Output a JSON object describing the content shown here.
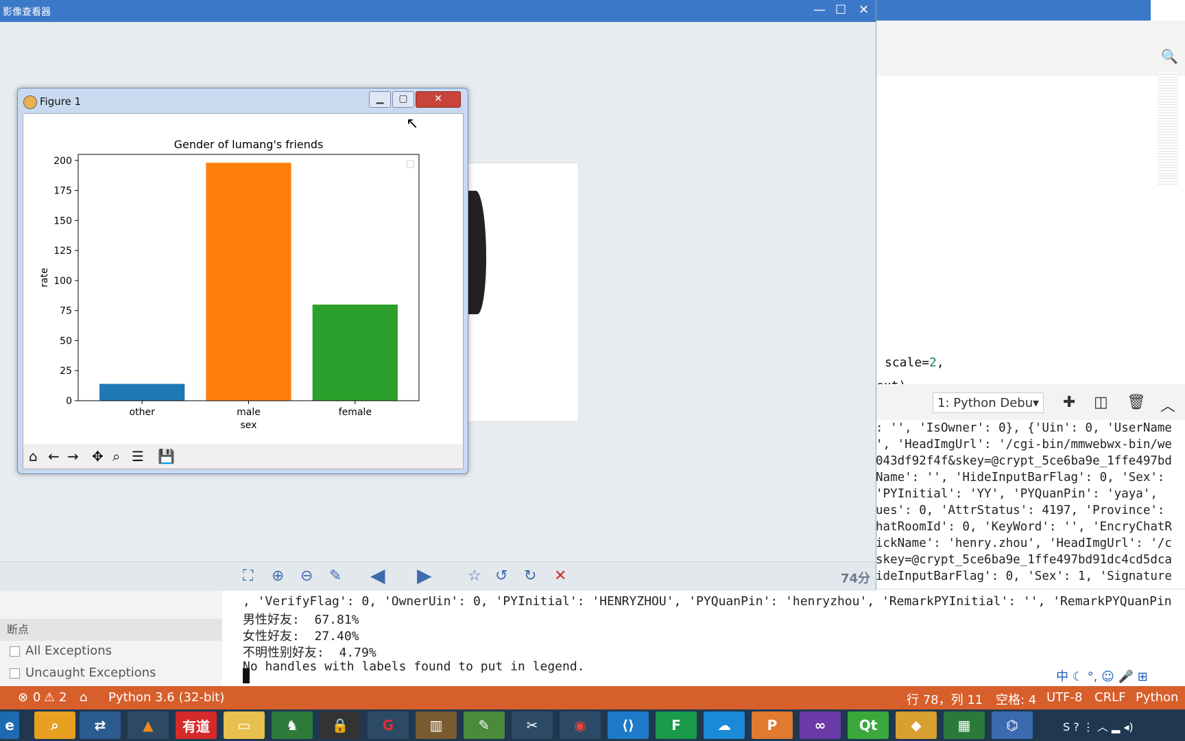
{
  "viewer": {
    "title": "影像查看器",
    "window_controls": {
      "minimize": "—",
      "maximize": "☐",
      "close": "✕"
    },
    "zoom": "74分",
    "toolbar_icons": [
      "fit-icon",
      "zoom-in-icon",
      "zoom-out-icon",
      "brush-icon",
      "prev-icon",
      "next-icon",
      "favorite-icon",
      "rotate-left-icon",
      "rotate-right-icon",
      "delete-icon"
    ]
  },
  "figure": {
    "title": "Figure 1",
    "toolbar_icons": [
      "home-icon",
      "back-icon",
      "forward-icon",
      "pan-icon",
      "zoom-icon",
      "configure-icon",
      "save-icon"
    ]
  },
  "chart_data": {
    "type": "bar",
    "title": "Gender of lumang's friends",
    "xlabel": "sex",
    "ylabel": "rate",
    "categories": [
      "other",
      "male",
      "female"
    ],
    "values": [
      14,
      198,
      80
    ],
    "colors": [
      "#1f77b4",
      "#ff7f0e",
      "#2ca02c"
    ],
    "ylim": [
      0,
      205
    ],
    "yticks": [
      0,
      25,
      50,
      75,
      100,
      125,
      150,
      175,
      200
    ],
    "grid": false,
    "legend": "top-right (empty)"
  },
  "editor": {
    "code_line1_pre": "scale=",
    "code_line1_num": "2",
    "code_line1_post": ",",
    "code_line2": "ext)"
  },
  "terminal": {
    "selector": "1: Python Debu",
    "lines": [
      ": '', 'IsOwner': 0}, {'Uin': 0, 'UserName",
      "', 'HeadImgUrl': '/cgi-bin/mmwebwx-bin/we",
      "043df92f4f&skey=@crypt_5ce6ba9e_1ffe497bd",
      "Name': '', 'HideInputBarFlag': 0, 'Sex': ",
      "'PYInitial': 'YY', 'PYQuanPin': 'yaya', ",
      "ues': 0, 'AttrStatus': 4197, 'Province': ",
      "hatRoomId': 0, 'KeyWord': '', 'EncryChatR",
      "ickName': 'henry.zhou', 'HeadImgUrl': '/c",
      "skey=@crypt_5ce6ba9e_1ffe497bd91dc4cd5dca",
      "ideInputBarFlag': 0, 'Sex': 1, 'Signature"
    ],
    "wide_line": ", 'VerifyFlag': 0, 'OwnerUin': 0, 'PYInitial': 'HENRYZHOU', 'PYQuanPin': 'henryzhou', 'RemarkPYInitial': '', 'RemarkPYQuanPin",
    "out1": "男性好友:  67.81%",
    "out2": "女性好友:  27.40%",
    "out3": "不明性别好友:  4.79%",
    "out4": "No handles with labels found to put in legend."
  },
  "breakpoints": {
    "heading": "断点",
    "items": [
      "All Exceptions",
      "Uncaught Exceptions"
    ]
  },
  "status": {
    "errors": "0",
    "warnings": "2",
    "python": "Python 3.6 (32-bit)",
    "position": "行 78，列 11",
    "spaces": "空格: 4",
    "encoding": "UTF-8",
    "eol": "CRLF",
    "language": "Python"
  },
  "taskbar": {
    "youdao": "有道",
    "qt": "Qt"
  }
}
